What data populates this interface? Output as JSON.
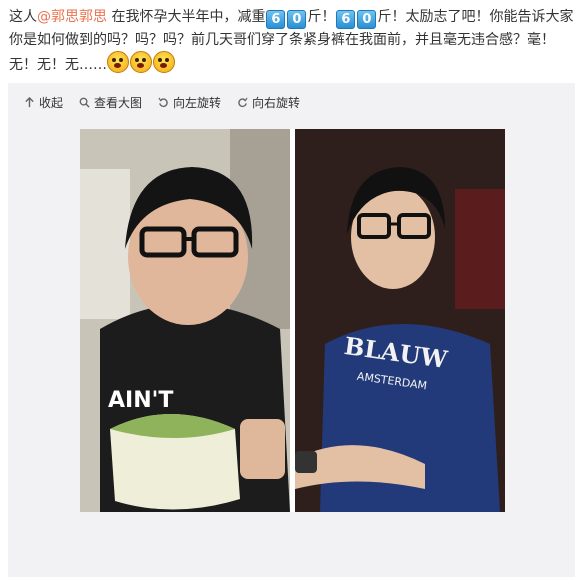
{
  "post": {
    "seg1": "这人",
    "mention": "@郭思郭思",
    "seg2": " 在我怀孕大半年中，减重",
    "num1a": "6",
    "num1b": "0",
    "seg3": "斤！",
    "num2a": "6",
    "num2b": "0",
    "seg4": "斤！太励志了吧！你能告诉大家你是如何做到的吗？吗？吗？前几天哥们穿了条紧身裤在我面前，并且毫无违合感？毫！无！无！无……",
    "emoji_names": [
      "shocked-emoji",
      "shocked-emoji",
      "shocked-emoji"
    ]
  },
  "toolbar": {
    "collapse": "收起",
    "view_large": "查看大图",
    "rotate_left": "向左旋转",
    "rotate_right": "向右旋转"
  },
  "photo": {
    "left_shirt_text": "AIN'T",
    "right_shirt_text": "BLAUW",
    "right_shirt_subtext": "AMSTERDAM"
  },
  "colors": {
    "mention": "#eb7350",
    "media_bg": "#f2f2f5",
    "numkey": "#2a8fd3"
  }
}
